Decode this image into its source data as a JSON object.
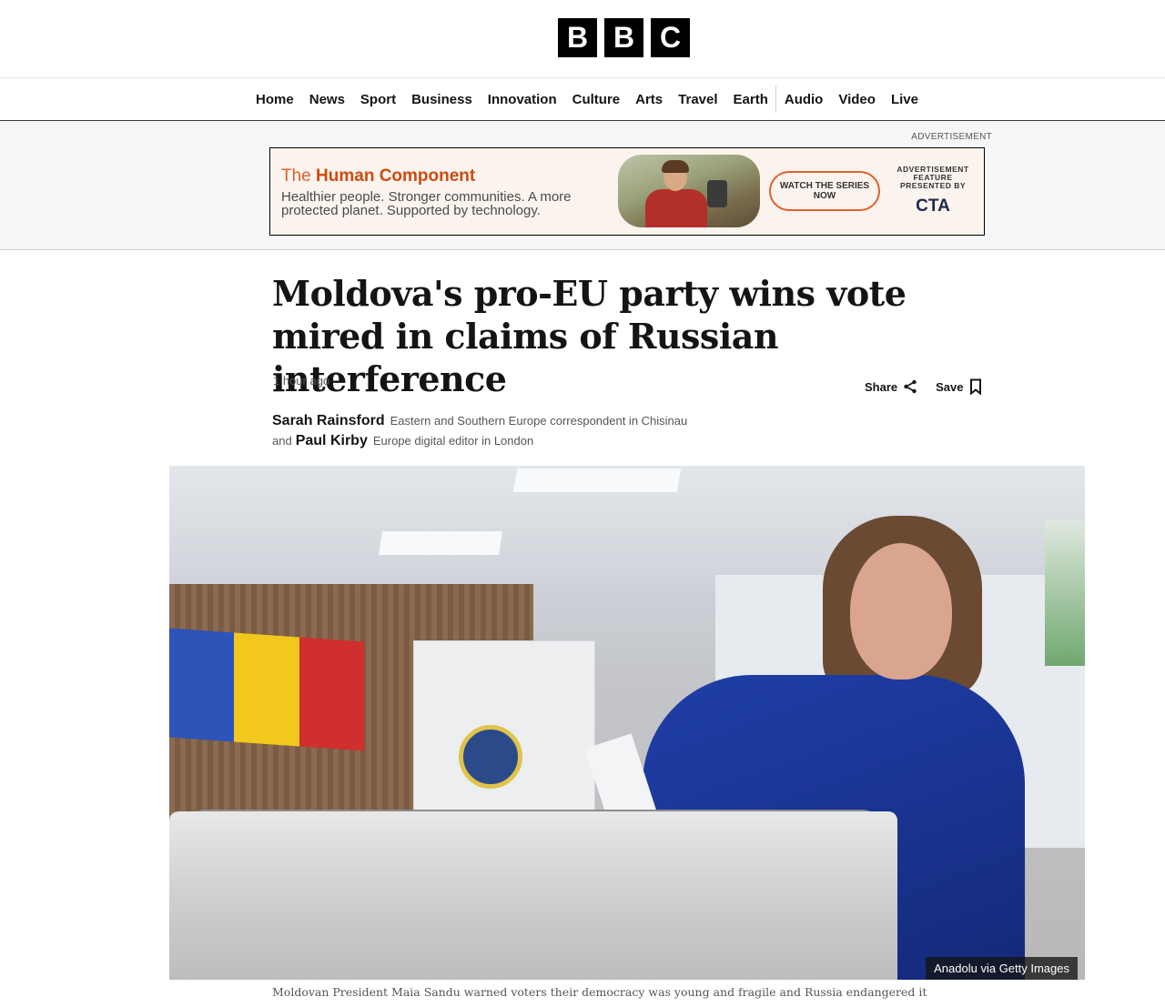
{
  "logo": {
    "letters": [
      "B",
      "B",
      "C"
    ]
  },
  "nav": {
    "items": [
      "Home",
      "News",
      "Sport",
      "Business",
      "Innovation",
      "Culture",
      "Arts",
      "Travel",
      "Earth",
      "Audio",
      "Video",
      "Live"
    ]
  },
  "ad": {
    "label": "ADVERTISEMENT",
    "title_prefix": "The ",
    "title_bold": "Human Component",
    "copy": "Healthier people. Stronger communities. A more protected planet. Supported by technology.",
    "cta": "WATCH THE SERIES NOW",
    "presented_by": "ADVERTISEMENT FEATURE PRESENTED BY",
    "brand": "CTA",
    "brand_color": "#1d2a4a",
    "accent_color": "#e35f2c"
  },
  "article": {
    "headline": "Moldova's pro-EU party wins vote mired in claims of Russian interference",
    "timestamp": "1 hour ago",
    "share_label": "Share",
    "save_label": "Save",
    "authors": [
      {
        "prefix": "",
        "name": "Sarah Rainsford",
        "role": "Eastern and Southern Europe correspondent in Chisinau"
      },
      {
        "prefix": "and",
        "name": "Paul Kirby",
        "role": "Europe digital editor in London"
      }
    ],
    "image_credit": "Anadolu via Getty Images",
    "caption": "Moldovan President Maia Sandu warned voters their democracy was young and fragile and Russia endangered it"
  }
}
